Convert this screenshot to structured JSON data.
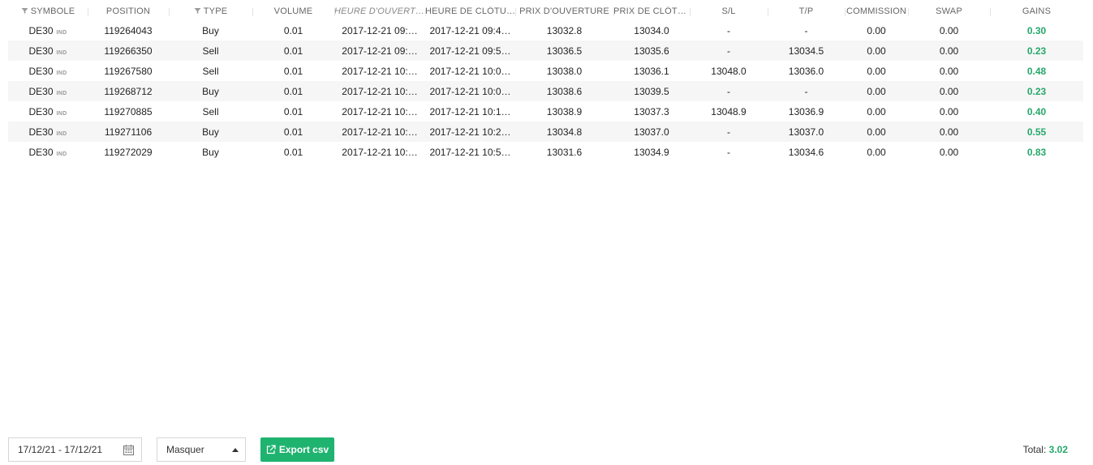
{
  "headers": {
    "symbol": "SYMBOLE",
    "position": "POSITION",
    "type": "TYPE",
    "volume": "VOLUME",
    "open_time": "HEURE D'OUVERTURE",
    "close_time": "HEURE DE CLÔTURE",
    "open_price": "PRIX D'OUVERTURE",
    "close_price": "PRIX DE CLÔTURE",
    "sl": "S/L",
    "tp": "T/P",
    "commission": "COMMISSION",
    "swap": "SWAP",
    "gains": "GAINS"
  },
  "rows": [
    {
      "symbol": "DE30",
      "tag": "IND",
      "position": "119264043",
      "type": "Buy",
      "volume": "0.01",
      "open_time": "2017-12-21 09:…",
      "close_time": "2017-12-21 09:4…",
      "open_price": "13032.8",
      "close_price": "13034.0",
      "sl": "-",
      "tp": "-",
      "commission": "0.00",
      "swap": "0.00",
      "gains": "0.30"
    },
    {
      "symbol": "DE30",
      "tag": "IND",
      "position": "119266350",
      "type": "Sell",
      "volume": "0.01",
      "open_time": "2017-12-21 09:…",
      "close_time": "2017-12-21 09:5…",
      "open_price": "13036.5",
      "close_price": "13035.6",
      "sl": "-",
      "tp": "13034.5",
      "commission": "0.00",
      "swap": "0.00",
      "gains": "0.23"
    },
    {
      "symbol": "DE30",
      "tag": "IND",
      "position": "119267580",
      "type": "Sell",
      "volume": "0.01",
      "open_time": "2017-12-21 10:…",
      "close_time": "2017-12-21 10:0…",
      "open_price": "13038.0",
      "close_price": "13036.1",
      "sl": "13048.0",
      "tp": "13036.0",
      "commission": "0.00",
      "swap": "0.00",
      "gains": "0.48"
    },
    {
      "symbol": "DE30",
      "tag": "IND",
      "position": "119268712",
      "type": "Buy",
      "volume": "0.01",
      "open_time": "2017-12-21 10:…",
      "close_time": "2017-12-21 10:0…",
      "open_price": "13038.6",
      "close_price": "13039.5",
      "sl": "-",
      "tp": "-",
      "commission": "0.00",
      "swap": "0.00",
      "gains": "0.23"
    },
    {
      "symbol": "DE30",
      "tag": "IND",
      "position": "119270885",
      "type": "Sell",
      "volume": "0.01",
      "open_time": "2017-12-21 10:…",
      "close_time": "2017-12-21 10:1…",
      "open_price": "13038.9",
      "close_price": "13037.3",
      "sl": "13048.9",
      "tp": "13036.9",
      "commission": "0.00",
      "swap": "0.00",
      "gains": "0.40"
    },
    {
      "symbol": "DE30",
      "tag": "IND",
      "position": "119271106",
      "type": "Buy",
      "volume": "0.01",
      "open_time": "2017-12-21 10:…",
      "close_time": "2017-12-21 10:2…",
      "open_price": "13034.8",
      "close_price": "13037.0",
      "sl": "-",
      "tp": "13037.0",
      "commission": "0.00",
      "swap": "0.00",
      "gains": "0.55"
    },
    {
      "symbol": "DE30",
      "tag": "IND",
      "position": "119272029",
      "type": "Buy",
      "volume": "0.01",
      "open_time": "2017-12-21 10:…",
      "close_time": "2017-12-21 10:5…",
      "open_price": "13031.6",
      "close_price": "13034.9",
      "sl": "-",
      "tp": "13034.6",
      "commission": "0.00",
      "swap": "0.00",
      "gains": "0.83"
    }
  ],
  "footer": {
    "date_range": "17/12/21 - 17/12/21",
    "select_value": "Masquer",
    "export_label": "Export csv",
    "total_label": "Total:",
    "total_value": "3.02"
  },
  "colors": {
    "gain_green": "#26a86b",
    "button_green": "#1fb370",
    "alt_row": "#f6f6f6"
  },
  "icons": {
    "filter": "filter-icon",
    "calendar": "calendar-icon",
    "caret": "caret-up-icon",
    "export": "export-icon"
  }
}
